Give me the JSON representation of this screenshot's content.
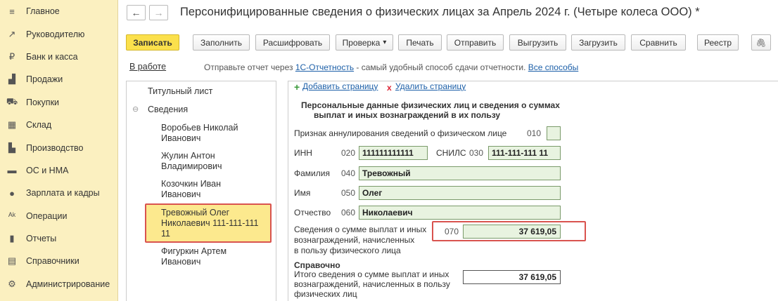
{
  "sidebar": {
    "items": [
      {
        "icon": "menu-icon",
        "glyph": "≡",
        "label": "Главное"
      },
      {
        "icon": "trend-icon",
        "glyph": "↗",
        "label": "Руководителю"
      },
      {
        "icon": "ruble-icon",
        "glyph": "₽",
        "label": "Банк и касса"
      },
      {
        "icon": "bag-icon",
        "glyph": "▟",
        "label": "Продажи"
      },
      {
        "icon": "cart-icon",
        "glyph": "⛟",
        "label": "Покупки"
      },
      {
        "icon": "warehouse-icon",
        "glyph": "▦",
        "label": "Склад"
      },
      {
        "icon": "factory-icon",
        "glyph": "▙",
        "label": "Производство"
      },
      {
        "icon": "truck-icon",
        "glyph": "▬",
        "label": "ОС и НМА"
      },
      {
        "icon": "user-icon",
        "glyph": "●",
        "label": "Зарплата и кадры"
      },
      {
        "icon": "operations-icon",
        "glyph": "ᴬᵏ",
        "label": "Операции"
      },
      {
        "icon": "bars-icon",
        "glyph": "▮",
        "label": "Отчеты"
      },
      {
        "icon": "book-icon",
        "glyph": "▤",
        "label": "Справочники"
      },
      {
        "icon": "gear-icon",
        "glyph": "⚙",
        "label": "Администрирование"
      }
    ]
  },
  "header": {
    "back_glyph": "←",
    "forward_glyph": "→",
    "title": "Персонифицированные сведения о физических лицах за Апрель 2024 г. (Четыре колеса ООО) *"
  },
  "toolbar": {
    "save": "Записать",
    "fill": "Заполнить",
    "decode": "Расшифровать",
    "check": "Проверка",
    "check_arrow": "▾",
    "print": "Печать",
    "send": "Отправить",
    "export": "Выгрузить",
    "load": "Загрузить",
    "compare": "Сравнить",
    "registry": "Реестр",
    "attach_glyph": "🖇"
  },
  "info": {
    "status": "В работе",
    "text_before": "Отправьте отчет через ",
    "link_1c": "1С-Отчетность",
    "text_after": " - самый удобный способ сдачи отчетности. ",
    "link_all": "Все способы"
  },
  "tree": {
    "title_page": "Титульный лист",
    "collapse_glyph": "⊖",
    "section": "Сведения",
    "persons": [
      {
        "line1": "Воробьев Николай",
        "line2": "Иванович",
        "line3": ""
      },
      {
        "line1": "Жулин Антон",
        "line2": "Владимирович",
        "line3": ""
      },
      {
        "line1": "Козочкин Иван",
        "line2": "Иванович",
        "line3": ""
      },
      {
        "line1": "Тревожный Олег",
        "line2": "Николаевич 111-111-111",
        "line3": "11"
      },
      {
        "line1": "Фигуркин Артем",
        "line2": "Иванович",
        "line3": ""
      }
    ]
  },
  "form": {
    "add_glyph": "+",
    "add_page": "Добавить страницу",
    "delete_glyph": "x",
    "delete_page": "Удалить страницу",
    "heading_1": "Персональные данные физических лиц и сведения о суммах",
    "heading_2": "выплат и иных вознаграждений в их пользу",
    "annul_label": "Признак аннулирования сведений о физическом лице",
    "annul_code": "010",
    "inn_label": "ИНН",
    "inn_code": "020",
    "inn_value": "111111111111",
    "snils_label": "СНИЛС",
    "snils_code": "030",
    "snils_value": "111-111-111 11",
    "surname_label": "Фамилия",
    "surname_code": "040",
    "surname_value": "Тревожный",
    "name_label": "Имя",
    "name_code": "050",
    "name_value": "Олег",
    "patronymic_label": "Отчество",
    "patronymic_code": "060",
    "patronymic_value": "Николаевич",
    "sum_label_1": "Сведения о сумме выплат и иных",
    "sum_label_2": "вознаграждений, начисленных",
    "sum_label_3": "в пользу физического лица",
    "sum_code": "070",
    "sum_value": "37 619,05",
    "ref_heading": "Справочно",
    "total_label_1": "Итого сведения о сумме выплат и иных",
    "total_label_2": "вознаграждений, начисленных в пользу",
    "total_label_3": "физических лиц",
    "total_value": "37 619,05"
  }
}
